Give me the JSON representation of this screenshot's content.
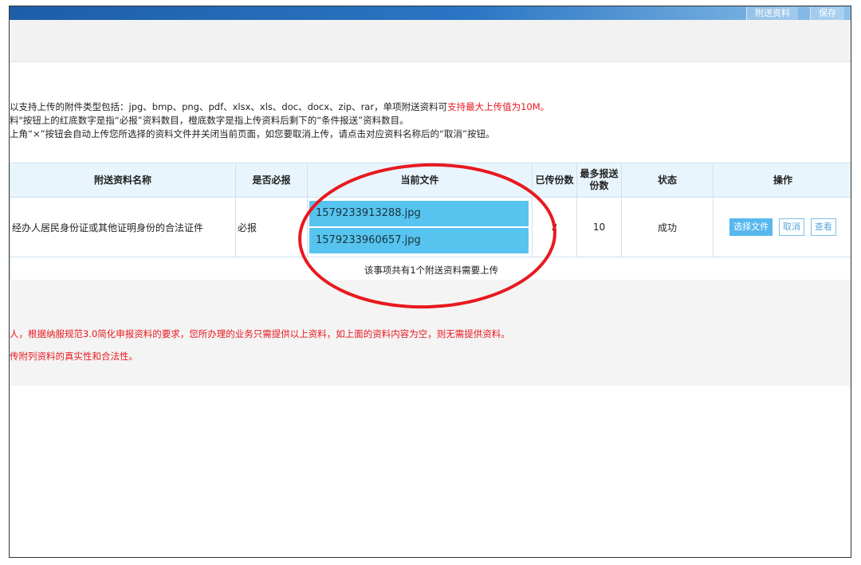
{
  "toolbar": {
    "attachments_label": "附送资料",
    "save_label": "保存"
  },
  "notes": {
    "line1_prefix": "以支持上传的附件类型包括：jpg、bmp、png、pdf、xlsx、xls、doc、docx、zip、rar，单项附送资料可",
    "line1_highlight": "支持最大上传值为10M。",
    "line2": "料\"按钮上的红底数字是指“必报”资料数目，橙底数字是指上传资料后剩下的“条件报送”资料数目。",
    "line3": "上角“×”按钮会自动上传您所选择的资料文件并关闭当前页面，如您要取消上传，请点击对应资料名称后的“取消”按钮。"
  },
  "table": {
    "headers": {
      "name": "附送资料名称",
      "required": "是否必报",
      "current_file": "当前文件",
      "uploaded": "已传份数",
      "max_line1": "最多报送",
      "max_line2": "份数",
      "status": "状态",
      "ops": "操作"
    },
    "row": {
      "name": "经办人居民身份证或其他证明身份的合法证件",
      "required": "必报",
      "files": [
        "1579233913288.jpg",
        "1579233960657.jpg"
      ],
      "uploaded": "2",
      "max": "10",
      "status": "成功",
      "ops": {
        "choose": "选择文件",
        "cancel": "取消",
        "view": "查看"
      }
    },
    "footer": "该事项共有1个附送资料需要上传"
  },
  "lower_notes": {
    "line1": "人，根据纳服规范3.0简化申报资料的要求，您所办理的业务只需提供以上资料，如上面的资料内容为空，则无需提供资料。",
    "line2": "传附列资料的真实性和合法性。"
  },
  "colors": {
    "header_bar": "#2a76c4",
    "file_highlight": "#56c4ee",
    "annotation_red": "#e8191f"
  }
}
